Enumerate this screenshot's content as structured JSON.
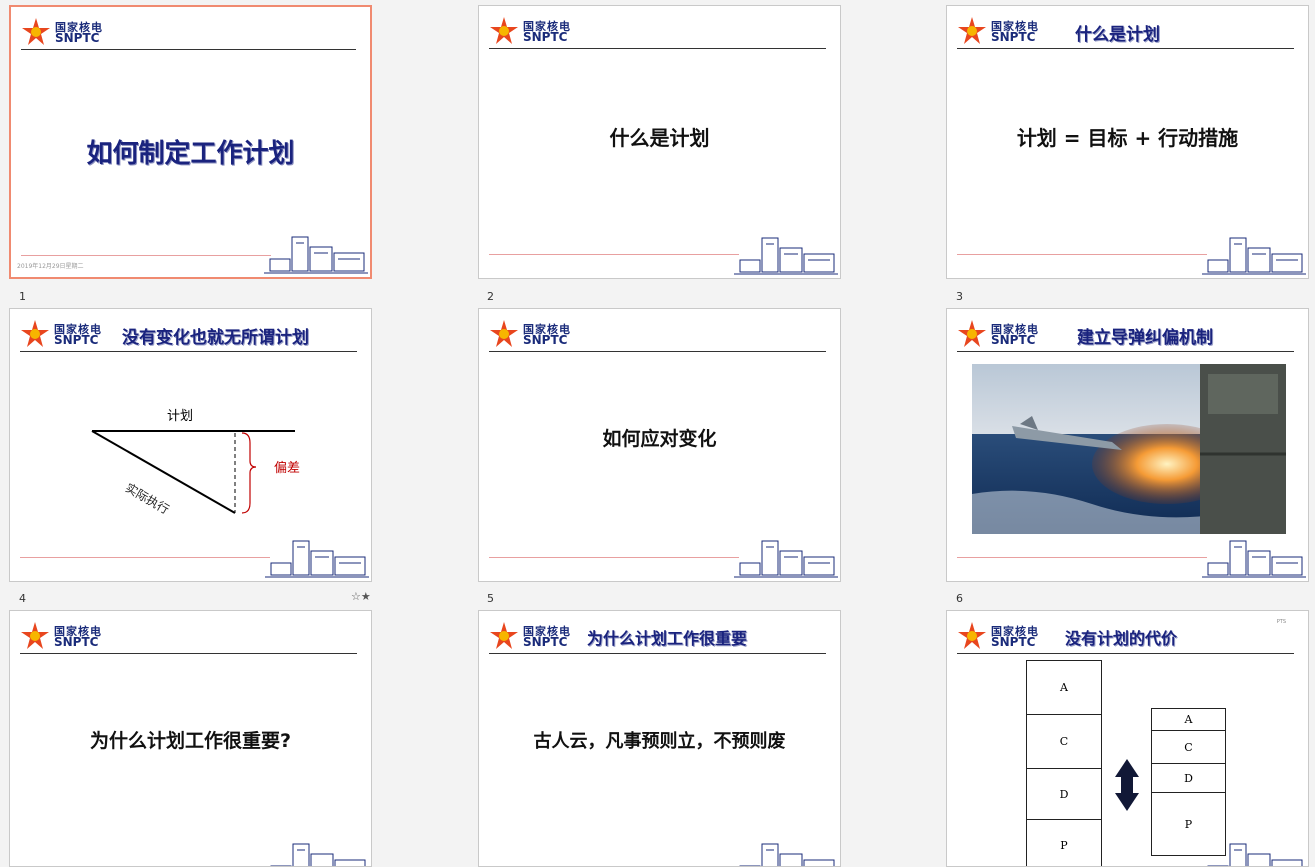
{
  "logo": {
    "cn": "国家核电",
    "en": "SNPTC"
  },
  "colors": {
    "accent_navy": "#1a237e",
    "selected_border": "#f08a70",
    "deviation_red": "#c00000"
  },
  "slides": [
    {
      "num": "1",
      "title": "如何制定工作计划",
      "date": "2019年12月29日星期二",
      "selected": true
    },
    {
      "num": "2",
      "title": "什么是计划"
    },
    {
      "num": "3",
      "header": "什么是计划",
      "title": "计划 = 目标 + 行动措施"
    },
    {
      "num": "4",
      "header": "没有变化也就无所谓计划",
      "plan_label": "计划",
      "actual_label": "实际执行",
      "deviation_label": "偏差"
    },
    {
      "num": "5",
      "title": "如何应对变化"
    },
    {
      "num": "6",
      "header": "建立导弹纠偏机制"
    },
    {
      "num": "",
      "title": "为什么计划工作很重要?"
    },
    {
      "num": "",
      "header": "为什么计划工作很重要",
      "title": "古人云，凡事预则立，不预则废"
    },
    {
      "num": "",
      "header": "没有计划的代价",
      "tag": "PTS",
      "left_stack": [
        "A",
        "C",
        "D",
        "P"
      ],
      "right_stack": [
        "A",
        "C",
        "D",
        "P"
      ]
    }
  ]
}
